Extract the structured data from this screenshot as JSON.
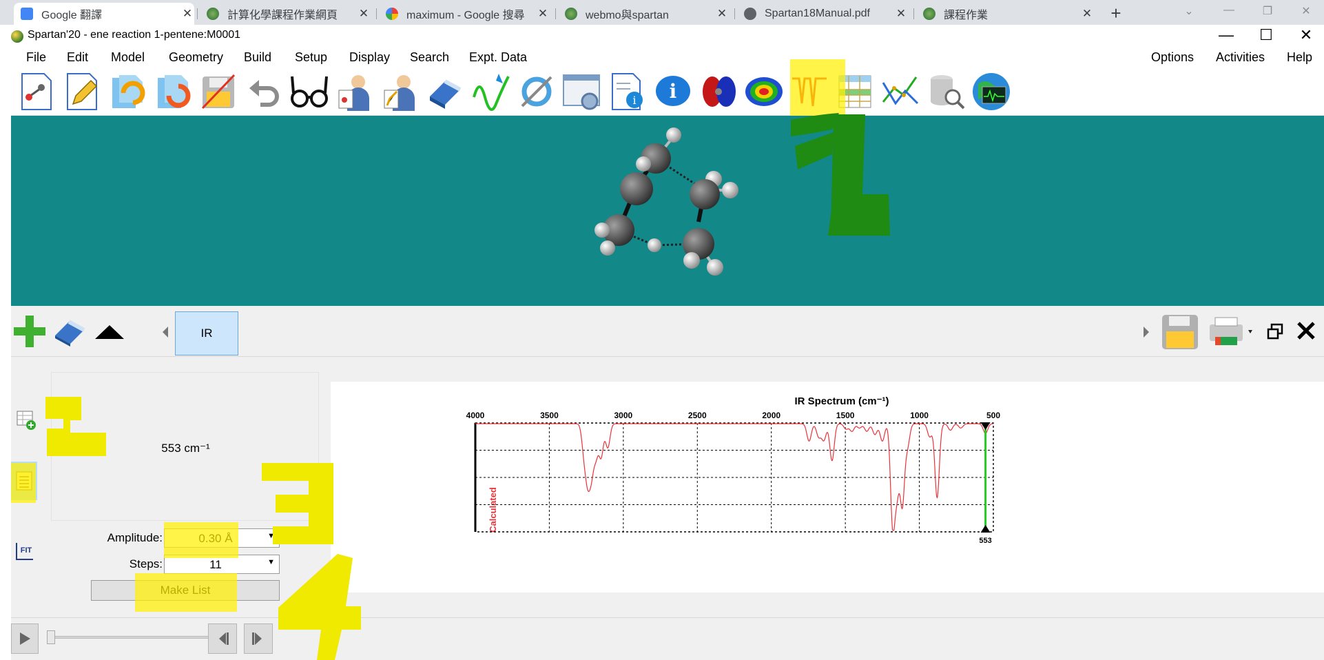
{
  "browser": {
    "tabs": [
      {
        "title": "Google 翻譯",
        "icon": "google-translate-icon"
      },
      {
        "title": "計算化學課程作業網頁",
        "icon": "webmo-icon"
      },
      {
        "title": "maximum - Google 搜尋",
        "icon": "google-icon"
      },
      {
        "title": "webmo與spartan",
        "icon": "webmo-icon"
      },
      {
        "title": "Spartan18Manual.pdf",
        "icon": "globe-icon"
      },
      {
        "title": "課程作業",
        "icon": "webmo-icon"
      }
    ],
    "close_symbol": "✕",
    "new_tab_symbol": "+"
  },
  "app": {
    "title": "Spartan'20 - ene reaction 1-pentene:M0001",
    "minimize": "—",
    "maximize": "☐",
    "close": "✕"
  },
  "menu": {
    "left": [
      "File",
      "Edit",
      "Model",
      "Geometry",
      "Build",
      "Setup",
      "Display",
      "Search",
      "Expt. Data"
    ],
    "right": [
      "Options",
      "Activities",
      "Help"
    ]
  },
  "toolbar": {
    "icons": [
      "new-molecule-icon",
      "edit-build-icon",
      "open-icon",
      "open-recent-icon",
      "save-icon",
      "undo-icon",
      "view-glasses-icon",
      "calculations-icon",
      "surfaces-icon",
      "clear-eraser-icon",
      "spectra-icon",
      "refresh-icon",
      "properties-icon",
      "output-icon",
      "info-icon",
      "orbital-icon",
      "potential-map-icon",
      "ir-spectrum-icon",
      "spreadsheet-icon",
      "plots-icon",
      "database-search-icon",
      "globe-monitor-icon"
    ]
  },
  "panel": {
    "tab_label": "IR"
  },
  "vibration": {
    "frequency_label": "553 cm⁻¹",
    "amplitude_label": "Amplitude:",
    "amplitude_value": "0.30 Å",
    "steps_label": "Steps:",
    "steps_value": "11",
    "make_list_label": "Make List",
    "fit_label": "FIT"
  },
  "annotations": {
    "marks": [
      "1",
      "2",
      "3",
      "4"
    ],
    "highlight_color": "#f5ec00",
    "marker_green": "#1f8b12"
  },
  "chart_data": {
    "type": "line",
    "title": "IR Spectrum (cm⁻¹)",
    "ylabel": "Calculated",
    "xlabel": "",
    "x_axis_reversed": true,
    "xlim": [
      4000,
      500
    ],
    "xticks": [
      4000,
      3500,
      3000,
      2500,
      2000,
      1500,
      1000,
      500
    ],
    "grid": true,
    "series_color": "#e8333a",
    "cursor": {
      "x": 553,
      "label": "553",
      "color": "#22cc22"
    },
    "peaks": [
      {
        "x": 3265,
        "depth": 0.26
      },
      {
        "x": 3240,
        "depth": 0.45
      },
      {
        "x": 3215,
        "depth": 0.4
      },
      {
        "x": 3185,
        "depth": 0.28
      },
      {
        "x": 3150,
        "depth": 0.3
      },
      {
        "x": 3105,
        "depth": 0.22
      },
      {
        "x": 1745,
        "depth": 0.16
      },
      {
        "x": 1680,
        "depth": 0.12
      },
      {
        "x": 1645,
        "depth": 0.15
      },
      {
        "x": 1590,
        "depth": 0.34
      },
      {
        "x": 1495,
        "depth": 0.05
      },
      {
        "x": 1455,
        "depth": 0.07
      },
      {
        "x": 1405,
        "depth": 0.04
      },
      {
        "x": 1355,
        "depth": 0.07
      },
      {
        "x": 1300,
        "depth": 0.1
      },
      {
        "x": 1250,
        "depth": 0.16
      },
      {
        "x": 1180,
        "depth": 0.92
      },
      {
        "x": 1150,
        "depth": 0.56
      },
      {
        "x": 1115,
        "depth": 0.73
      },
      {
        "x": 1080,
        "depth": 0.2
      },
      {
        "x": 930,
        "depth": 0.12
      },
      {
        "x": 880,
        "depth": 0.68
      },
      {
        "x": 790,
        "depth": 0.06
      },
      {
        "x": 720,
        "depth": 0.04
      },
      {
        "x": 553,
        "depth": 0.09
      }
    ]
  }
}
